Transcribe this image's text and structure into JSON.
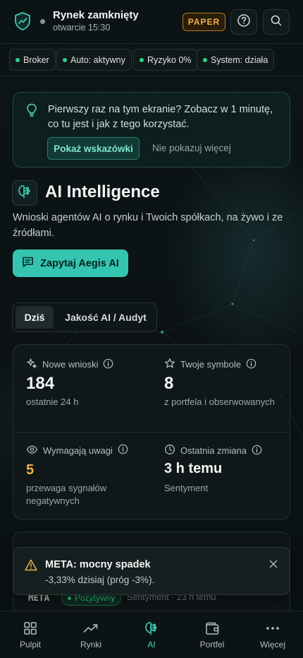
{
  "header": {
    "market_title": "Rynek zamknięty",
    "market_sub": "otwarcie 15:30",
    "mode_badge": "PAPER",
    "logo_icon": "shield-chart-icon",
    "help_icon": "question-circle-icon",
    "search_icon": "search-icon"
  },
  "status_pills": [
    {
      "label": "Broker"
    },
    {
      "label": "Auto: aktywny"
    },
    {
      "label": "Ryzyko 0%"
    },
    {
      "label": "System: działa"
    }
  ],
  "hint": {
    "text": "Pierwszy raz na tym ekranie? Zobacz w 1 minutę, co tu jest i jak z tego korzystać.",
    "show_button": "Pokaż wskazówki",
    "dismiss_link": "Nie pokazuj więcej",
    "icon": "lightbulb-icon"
  },
  "ai": {
    "title": "AI Intelligence",
    "description": "Wnioski agentów AI o rynku i Twoich spółkach, na żywo i ze źródłami.",
    "ask_button": "Zapytaj Aegis AI",
    "icon": "brain-icon"
  },
  "tabs": [
    {
      "label": "Dziś",
      "active": true
    },
    {
      "label": "Jakość AI / Audyt",
      "active": false
    }
  ],
  "stats": [
    {
      "label": "Nowe wnioski",
      "value": "184",
      "sub": "ostatnie 24 h",
      "icon": "sparkles-icon"
    },
    {
      "label": "Twoje symbole",
      "value": "8",
      "sub": "z portfela i obserwowanych",
      "icon": "star-icon"
    },
    {
      "label": "Wymagają uwagi",
      "value": "5",
      "sub": "przewaga sygnałów negatywnych",
      "icon": "eye-icon"
    },
    {
      "label": "Ostatnia zmiana",
      "value": "3 h temu",
      "sub": "Sentyment",
      "icon": "clock-icon"
    }
  ],
  "feed_row": {
    "ticker": "META",
    "badge": "Pozytywny",
    "meta": "Sentyment · 23 h temu"
  },
  "toast": {
    "title": "META: mocny spadek",
    "body": "-3,33% dzisiaj (próg -3%).",
    "icon": "warning-triangle-icon",
    "close_icon": "close-icon"
  },
  "bottom_nav": [
    {
      "label": "Pulpit",
      "icon": "grid-icon",
      "active": false
    },
    {
      "label": "Rynki",
      "icon": "trend-up-icon",
      "active": false
    },
    {
      "label": "AI",
      "icon": "brain-icon",
      "active": true
    },
    {
      "label": "Portfel",
      "icon": "wallet-icon",
      "active": false
    },
    {
      "label": "Więcej",
      "icon": "more-dots-icon",
      "active": false
    }
  ],
  "colors": {
    "accent": "#34c5b0",
    "positive": "#2fd08a",
    "warning": "#f3b04a",
    "background": "#0b1213"
  }
}
